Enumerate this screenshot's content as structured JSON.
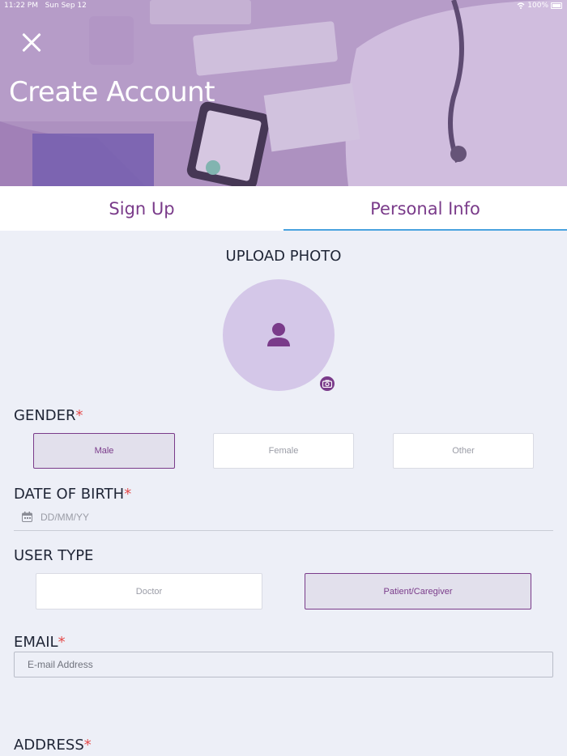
{
  "status_bar": {
    "time": "11:22 PM",
    "date": "Sun Sep 12",
    "battery": "100%"
  },
  "header": {
    "title": "Create Account",
    "close_icon": "close-icon"
  },
  "tabs": [
    {
      "label": "Sign Up",
      "active": false
    },
    {
      "label": "Personal Info",
      "active": true
    }
  ],
  "upload": {
    "title": "UPLOAD PHOTO"
  },
  "gender": {
    "title": "GENDER",
    "required_mark": "*",
    "options": [
      "Male",
      "Female",
      "Other"
    ],
    "selected": "Male"
  },
  "dob": {
    "title": "DATE OF BIRTH",
    "required_mark": "*",
    "placeholder": "DD/MM/YY"
  },
  "user_type": {
    "title": "USER TYPE",
    "options": [
      "Doctor",
      "Patient/Caregiver"
    ],
    "selected": "Patient/Caregiver"
  },
  "email": {
    "title": "EMAIL",
    "required_mark": "*",
    "placeholder": "E-mail Address"
  },
  "address": {
    "title": "ADDRESS",
    "required_mark": "*"
  },
  "colors": {
    "accent": "#7a3b8a",
    "tab_underline": "#4aa3df",
    "required": "#e54b4b",
    "avatar_bg": "#d4c7e8"
  }
}
